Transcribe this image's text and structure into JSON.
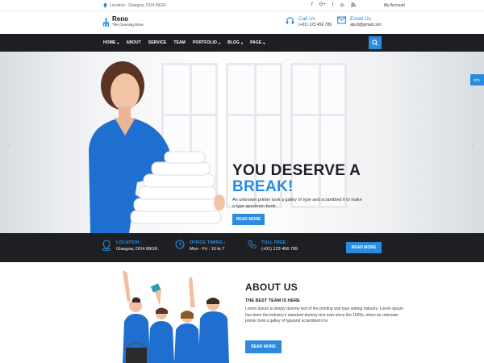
{
  "topbar": {
    "location": "Location : Glasgow, DO4 89GR",
    "social": [
      "f",
      "G+",
      "t",
      "◎",
      "rss"
    ],
    "account": "My Account"
  },
  "brand": {
    "name": "Reno",
    "tagline": "The Cleaning Store"
  },
  "contact": {
    "call_title": "Call Us",
    "call_value": "(+01) 123 456 789",
    "email_title": "Email Us",
    "email_value": "abcd@gmail.com"
  },
  "nav": {
    "items": [
      {
        "label": "HOME",
        "caret": true
      },
      {
        "label": "ABOUT",
        "caret": false
      },
      {
        "label": "SERVICE",
        "caret": false
      },
      {
        "label": "TEAM",
        "caret": false
      },
      {
        "label": "PORTFOLIO",
        "caret": true
      },
      {
        "label": "BLOG",
        "caret": true
      },
      {
        "label": "PAGE",
        "caret": true
      }
    ]
  },
  "hero": {
    "title_line1": "YOU DESERVE A",
    "title_line2": "BREAK!",
    "text": "An unknown printer took a galley of type and scrambled it to make a type specimen book.",
    "button": "READ MORE",
    "side_tab": "RTL"
  },
  "infobar": {
    "location_title": "LOCATION :",
    "location_value": "Glasgow, DO4 89GR.",
    "timing_title": "OFFICE TIMING :",
    "timing_value": "Mon - Fri : 10 to 7",
    "toll_title": "TOLL FREE :",
    "toll_value": "(+01) 123 456 789",
    "button": "READ MORE"
  },
  "about": {
    "title": "ABOUT US",
    "subtitle": "THE BEST TEAM IS HERE",
    "text": "Lorem Ipsum is simply dummy text of the printing and type setting industry. Lorem Ipsum has been the industry's standard dummy text ever since the 1500s, when an unknown printer took a galley of typeand scrambled it to",
    "button": "READ MORE"
  },
  "colors": {
    "accent": "#2a8be0",
    "dark": "#1d1f23"
  }
}
